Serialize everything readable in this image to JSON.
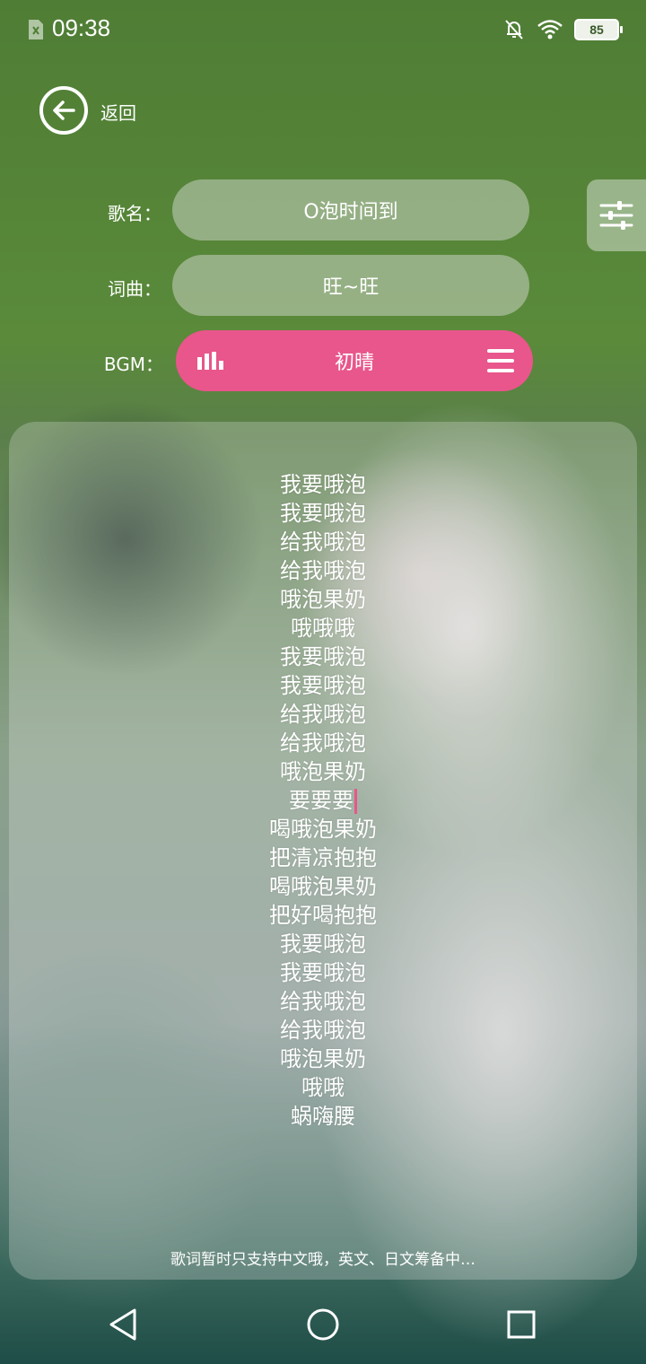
{
  "status_bar": {
    "time": "09:38",
    "battery": "85",
    "icons": [
      "sim-icon",
      "mute-bell-icon",
      "wifi-icon",
      "battery-icon"
    ]
  },
  "header": {
    "back_label": "返回"
  },
  "form": {
    "song_label": "歌名：",
    "song_value": "O泡时间到",
    "lyricist_label": "词曲：",
    "lyricist_value": "旺~旺",
    "bgm_label": "BGM：",
    "bgm_value": "初晴"
  },
  "lyrics": [
    "我要哦泡",
    "我要哦泡",
    "给我哦泡",
    "给我哦泡",
    "哦泡果奶",
    "哦哦哦",
    "我要哦泡",
    "我要哦泡",
    "给我哦泡",
    "给我哦泡",
    "哦泡果奶",
    "要要要",
    "喝哦泡果奶",
    "把清凉抱抱",
    "喝哦泡果奶",
    "把好喝抱抱",
    "我要哦泡",
    "我要哦泡",
    "给我哦泡",
    "给我哦泡",
    "哦泡果奶",
    "哦哦",
    "蜗嗨腰"
  ],
  "notice": "歌词暂时只支持中文哦，英文、日文筹备中…",
  "colors": {
    "accent": "#e8568b",
    "pill": "rgba(200,210,195,0.55)"
  }
}
